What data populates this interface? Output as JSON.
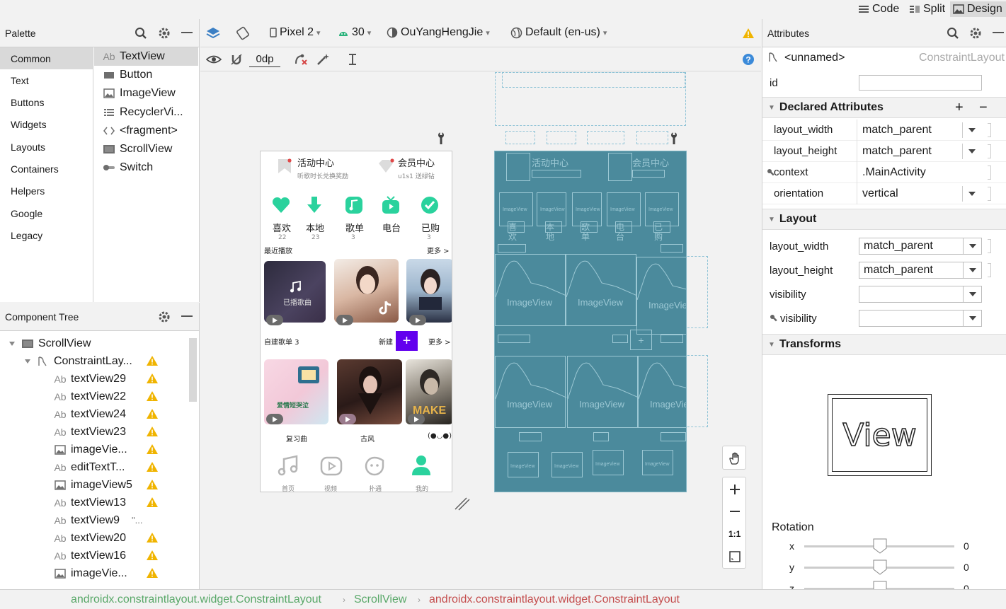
{
  "topbar": {
    "code": "Code",
    "split": "Split",
    "design": "Design"
  },
  "palette": {
    "title": "Palette",
    "categories": [
      "Common",
      "Text",
      "Buttons",
      "Widgets",
      "Layouts",
      "Containers",
      "Helpers",
      "Google",
      "Legacy"
    ],
    "items": [
      {
        "icon": "Ab",
        "label": "TextView"
      },
      {
        "icon": "button",
        "label": "Button"
      },
      {
        "icon": "image",
        "label": "ImageView"
      },
      {
        "icon": "list",
        "label": "RecyclerVi..."
      },
      {
        "icon": "code",
        "label": "<fragment>"
      },
      {
        "icon": "scroll",
        "label": "ScrollView"
      },
      {
        "icon": "switch",
        "label": "Switch"
      }
    ]
  },
  "tree": {
    "title": "Component Tree",
    "rows": [
      {
        "label": "ScrollView",
        "icon": "scroll"
      },
      {
        "label": "ConstraintLay...",
        "icon": "constraint"
      },
      {
        "label": "textView29",
        "icon": "Ab"
      },
      {
        "label": "textView22",
        "icon": "Ab"
      },
      {
        "label": "textView24",
        "icon": "Ab"
      },
      {
        "label": "textView23",
        "icon": "Ab"
      },
      {
        "label": "imageVie...",
        "icon": "image"
      },
      {
        "label": "editTextT...",
        "icon": "Ab"
      },
      {
        "label": "imageView5",
        "icon": "image"
      },
      {
        "label": "textView13",
        "icon": "Ab"
      },
      {
        "label": "textView9",
        "icon": "Ab",
        "extra": "\"..."
      },
      {
        "label": "textView20",
        "icon": "Ab"
      },
      {
        "label": "textView16",
        "icon": "Ab"
      },
      {
        "label": "imageVie...",
        "icon": "image"
      }
    ]
  },
  "toolbar": {
    "device": "Pixel 2",
    "api": "30",
    "theme": "OuYangHengJie",
    "locale": "Default (en-us)",
    "margin": "0dp"
  },
  "phone": {
    "hd1_title": "活动中心",
    "hd1_sub": "听歌时长兑换奖励",
    "hd2_title": "会员中心",
    "hd2_sub": "u1s1 送绿钻",
    "icons": [
      {
        "label": "喜欢",
        "count": "22"
      },
      {
        "label": "本地",
        "count": "23"
      },
      {
        "label": "歌单",
        "count": "3"
      },
      {
        "label": "电台",
        "count": ""
      },
      {
        "label": "已购",
        "count": "3"
      }
    ],
    "recent": "最近播放",
    "more": "更多 >",
    "thumb_text": "已播歌曲",
    "playlist": "自建歌单 3",
    "new": "新建",
    "more2": "更多 >",
    "cap1": "复习曲",
    "cap2": "古风",
    "cap3": "(●◡●)",
    "nav": [
      "首页",
      "视频",
      "扑通",
      "我的"
    ]
  },
  "blueprint": {
    "imageview": "ImageView",
    "small": "ImageView"
  },
  "attributes": {
    "title": "Attributes",
    "component": "<unnamed>",
    "component_type": "ConstraintLayout",
    "id_label": "id",
    "declared": "Declared Attributes",
    "declared_rows": [
      {
        "k": "layout_width",
        "v": "match_parent"
      },
      {
        "k": "layout_height",
        "v": "match_parent"
      },
      {
        "k": "context",
        "v": ".MainActivity"
      },
      {
        "k": "orientation",
        "v": "vertical"
      }
    ],
    "layout": "Layout",
    "layout_rows": [
      {
        "k": "layout_width",
        "v": "match_parent"
      },
      {
        "k": "layout_height",
        "v": "match_parent"
      },
      {
        "k": "visibility",
        "v": ""
      },
      {
        "k": "visibility",
        "v": ""
      }
    ],
    "transforms": "Transforms",
    "view_text": "View",
    "rotation": "Rotation",
    "rot": [
      {
        "k": "x",
        "v": "0"
      },
      {
        "k": "y",
        "v": "0"
      },
      {
        "k": "z",
        "v": "0"
      }
    ]
  },
  "zoom": {
    "ratio": "1:1"
  },
  "breadcrumb": [
    "androidx.constraintlayout.widget.ConstraintLayout",
    "ScrollView",
    "androidx.constraintlayout.widget.ConstraintLayout"
  ],
  "colors": {
    "accent": "#2ad29d",
    "purple": "#6200ee",
    "blueprint": "#4b8a9c",
    "warn": "#f0b400",
    "crumb_green": "#59a869",
    "crumb_red": "#c44e4e"
  }
}
